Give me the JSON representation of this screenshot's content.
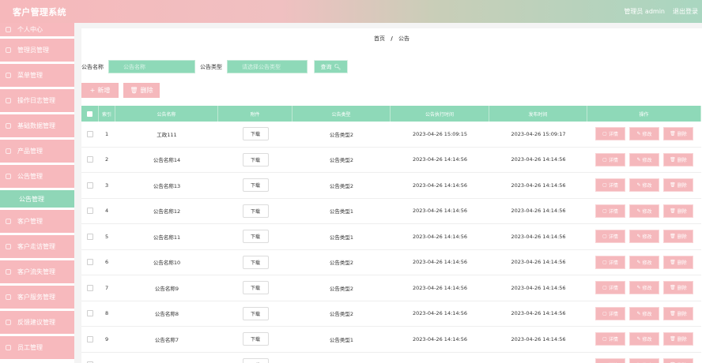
{
  "header": {
    "title": "客户管理系统",
    "user_label": "管理员 admin",
    "logout_label": "退出登录"
  },
  "sidebar": {
    "items": [
      {
        "label": "个人中心"
      },
      {
        "label": "管理员管理"
      },
      {
        "label": "菜单管理"
      },
      {
        "label": "操作日志管理"
      },
      {
        "label": "基础数据管理"
      },
      {
        "label": "产品管理"
      },
      {
        "label": "公告管理"
      }
    ],
    "active_sub": "公告管理",
    "items_after": [
      {
        "label": "客户管理"
      },
      {
        "label": "客户走访管理"
      },
      {
        "label": "客户流失管理"
      },
      {
        "label": "客户服务管理"
      },
      {
        "label": "反馈建议管理"
      },
      {
        "label": "员工管理"
      }
    ]
  },
  "breadcrumb": {
    "home": "首页",
    "sep": "/",
    "current": "公告"
  },
  "search": {
    "name_label": "公告名称",
    "name_placeholder": "公告名称",
    "type_label": "公告类型",
    "type_placeholder": "请选择公告类型",
    "button_label": "查询",
    "button_icon": "search-icon"
  },
  "actions": {
    "add_label": "新增",
    "delete_label": "删除"
  },
  "table": {
    "headers": {
      "index": "索引",
      "name": "公告名称",
      "file": "附件",
      "type": "公告类型",
      "exec_time": "公告执行时间",
      "pub_time": "发布时间",
      "ops": "操作"
    },
    "download_label": "下载",
    "op_labels": {
      "detail": "详情",
      "edit": "修改",
      "delete": "删除"
    },
    "rows": [
      {
        "index": "1",
        "name": "工政111",
        "type": "公告类型2",
        "exec_time": "2023-04-26 15:09:15",
        "pub_time": "2023-04-26 15:09:17"
      },
      {
        "index": "2",
        "name": "公告名称14",
        "type": "公告类型2",
        "exec_time": "2023-04-26 14:14:56",
        "pub_time": "2023-04-26 14:14:56"
      },
      {
        "index": "3",
        "name": "公告名称13",
        "type": "公告类型2",
        "exec_time": "2023-04-26 14:14:56",
        "pub_time": "2023-04-26 14:14:56"
      },
      {
        "index": "4",
        "name": "公告名称12",
        "type": "公告类型1",
        "exec_time": "2023-04-26 14:14:56",
        "pub_time": "2023-04-26 14:14:56"
      },
      {
        "index": "5",
        "name": "公告名称11",
        "type": "公告类型1",
        "exec_time": "2023-04-26 14:14:56",
        "pub_time": "2023-04-26 14:14:56"
      },
      {
        "index": "6",
        "name": "公告名称10",
        "type": "公告类型2",
        "exec_time": "2023-04-26 14:14:56",
        "pub_time": "2023-04-26 14:14:56"
      },
      {
        "index": "7",
        "name": "公告名称9",
        "type": "公告类型2",
        "exec_time": "2023-04-26 14:14:56",
        "pub_time": "2023-04-26 14:14:56"
      },
      {
        "index": "8",
        "name": "公告名称8",
        "type": "公告类型2",
        "exec_time": "2023-04-26 14:14:56",
        "pub_time": "2023-04-26 14:14:56"
      },
      {
        "index": "9",
        "name": "公告名称7",
        "type": "公告类型1",
        "exec_time": "2023-04-26 14:14:56",
        "pub_time": "2023-04-26 14:14:56"
      },
      {
        "index": "",
        "name": "",
        "type": "",
        "exec_time": "",
        "pub_time": ""
      }
    ]
  },
  "colors": {
    "header_gradient_start": "#f6b8bb",
    "header_gradient_end": "#a9d6c0",
    "pink_accent": "#f5b8bc",
    "green_accent": "#8ed9b8"
  }
}
